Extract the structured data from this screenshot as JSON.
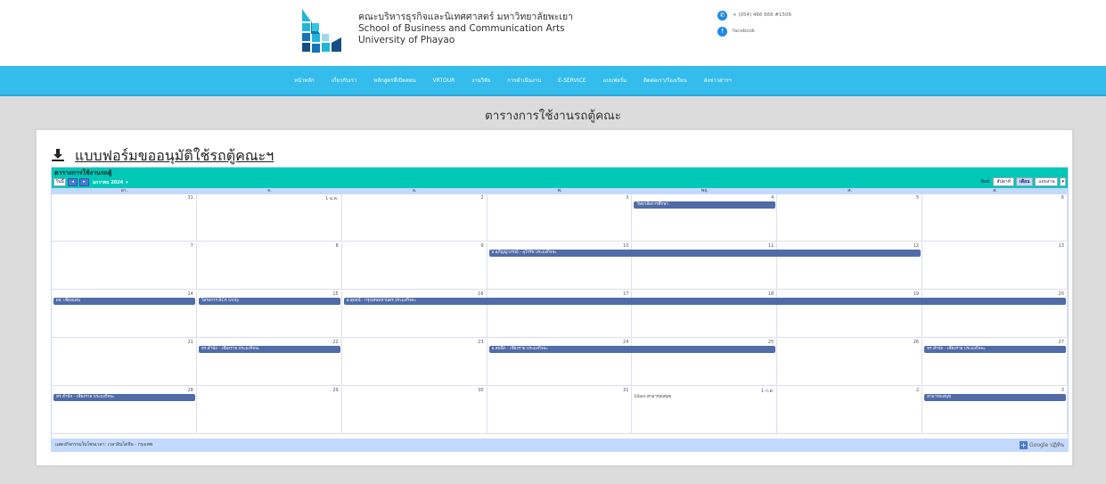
{
  "header": {
    "faculty_th": "คณะบริหารธุรกิจและนิเทศศาสตร์ มหาวิทยาลัยพะเยา",
    "faculty_en1": "School of Business and Communication Arts",
    "faculty_en2": "University of Phayao",
    "phone": "+ (054) 466 666 #1506",
    "facebook": "facebook",
    "accent_color": "#33bcec"
  },
  "nav": [
    "หน้าหลัก",
    "เกี่ยวกับเรา",
    "หลักสูตรที่เปิดสอน",
    "VRTOUR",
    "งานวิจัย",
    "การดำเนินงาน",
    "E-SERVICE",
    "แบบฟอร์ม",
    "ติดต่อเรา/ร้องเรียน",
    "ส่งข่าวสารฯ"
  ],
  "page_title": "ตารางการใช้งานรถตู้คณะ",
  "form_link": "แบบฟอร์มขออนุมัติใช้รถตู้คณะฯ",
  "calendar": {
    "title": "ตารางการใช้งานรถตู้",
    "today_button": "วันนี้",
    "month_label": "มกราคม 2024",
    "tabs": {
      "print": "พิมพ์",
      "week": "สัปดาห์",
      "month": "เดือน",
      "agenda": "แถบงาน"
    },
    "day_headers": [
      "อา.",
      "จ.",
      "อ.",
      "พ.",
      "พฤ.",
      "ศ.",
      "ส."
    ],
    "weeks": [
      [
        "31",
        "1 ม.ค.",
        "2",
        "3",
        "4",
        "5",
        "6"
      ],
      [
        "7",
        "8",
        "9",
        "10",
        "11",
        "12",
        "13"
      ],
      [
        "14",
        "15",
        "16",
        "17",
        "18",
        "19",
        "20"
      ],
      [
        "21",
        "22",
        "23",
        "24",
        "25",
        "26",
        "27"
      ],
      [
        "28",
        "29",
        "30",
        "31",
        "1 ก.พ.",
        "2",
        "3"
      ]
    ],
    "events": [
      {
        "week": 0,
        "start": 4,
        "span": 1,
        "title": "วิทยาลัยการศึกษา"
      },
      {
        "week": 1,
        "start": 3,
        "span": 3,
        "title": "อ.อภิญญาภรณ์ - อุไรรัช ประมงกิจจะ"
      },
      {
        "week": 2,
        "start": 0,
        "span": 1,
        "title": "ผจ. เชียงแสน"
      },
      {
        "week": 2,
        "start": 1,
        "span": 1,
        "title": "โครงการ BCA Unity"
      },
      {
        "week": 2,
        "start": 2,
        "span": 5,
        "title": "อ.สุพจน์ - กรุงเทพมหานคร ประมงกิจจะ"
      },
      {
        "week": 3,
        "start": 1,
        "span": 1,
        "title": "ทร.สำนัก - เชียงราย ประมงกิจจะ"
      },
      {
        "week": 3,
        "start": 3,
        "span": 2,
        "title": "อ.สมนึก - เชียงราย ประมงกิจจะ"
      },
      {
        "week": 3,
        "start": 6,
        "span": 1,
        "title": "ทร.สำนัก - เชียงราย ประมงกิจจะ"
      },
      {
        "week": 4,
        "start": 0,
        "span": 1,
        "title": "ทร.สำนัก - เชียงราย ประมงกิจจะ"
      },
      {
        "week": 4,
        "start": 4,
        "span": 1,
        "title": "10am สามารถเสนุข",
        "plain": true
      },
      {
        "week": 4,
        "start": 6,
        "span": 1,
        "title": "สามารถเสนุข"
      }
    ],
    "timezone": "แสดงกิจกรรมในโซนเวลา: เวลาอินโดจีน - กรุงเทพ",
    "google_label": "Google ปฏิทิน"
  }
}
